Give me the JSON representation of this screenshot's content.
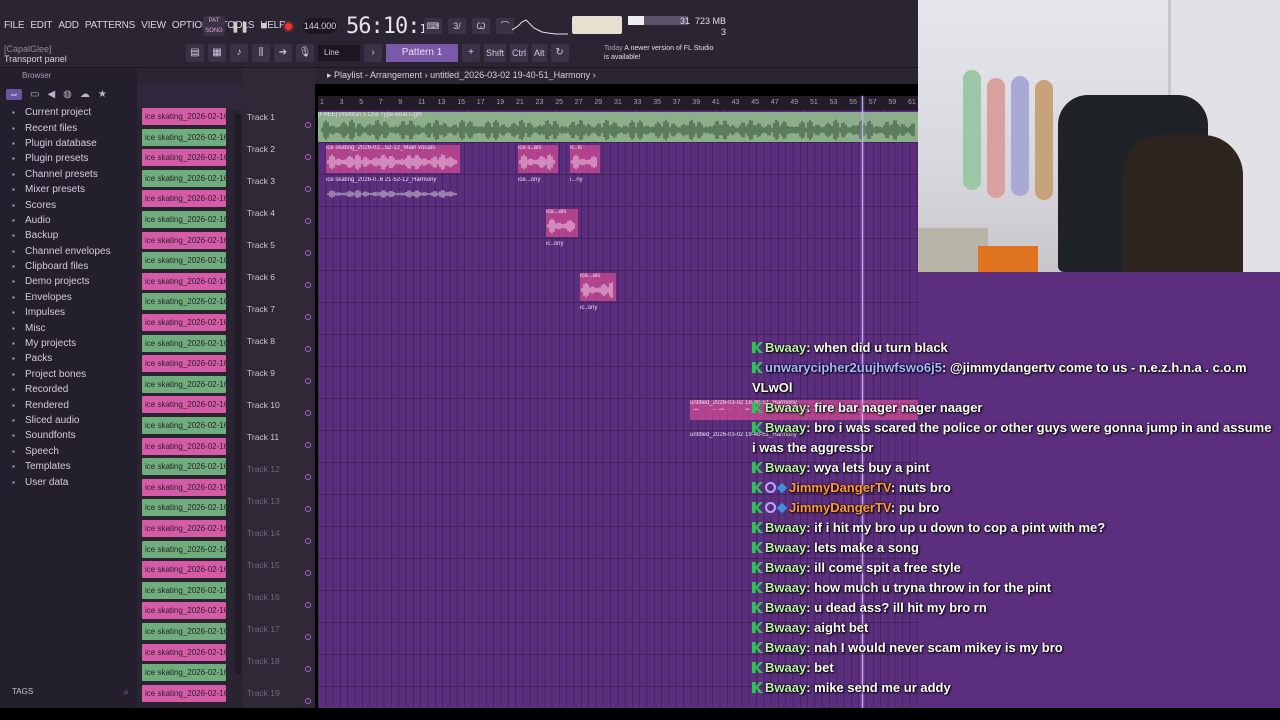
{
  "menu": [
    "FILE",
    "EDIT",
    "ADD",
    "PATTERNS",
    "VIEW",
    "OPTIONS",
    "TOOLS",
    "HELP"
  ],
  "hint": {
    "line1": "[CapalGlee]",
    "line2": "Transport panel"
  },
  "transport": {
    "mode": "SONG",
    "tempo": "144.000",
    "time_main": "56:10",
    "time_sub": "10",
    "cpu_value": "31",
    "memory": "723 MB",
    "voices": "3"
  },
  "toolbar2": {
    "snap": "Line",
    "pattern": "Pattern 1",
    "keys": [
      "Shift",
      "Ctrl",
      "Alt"
    ],
    "news_title": "Today",
    "news_text": "A newer version of FL Studio is available!"
  },
  "browser": {
    "title": "Browser",
    "items": [
      "Current project",
      "Recent files",
      "Plugin database",
      "Plugin presets",
      "Channel presets",
      "Mixer presets",
      "Scores",
      "Audio",
      "Backup",
      "Channel envelopes",
      "Clipboard files",
      "Demo projects",
      "Envelopes",
      "Impulses",
      "Misc",
      "My projects",
      "Packs",
      "Project bones",
      "Recorded",
      "Rendered",
      "Sliced audio",
      "Soundfonts",
      "Speech",
      "Templates",
      "User data"
    ],
    "tags_label": "TAGS"
  },
  "clip_label": "ice skating_2026-02-16...",
  "playlist": {
    "path": "Playlist - Arrangement",
    "project": "untitled_2026-03-02 19-40-51_Harmony",
    "ruler": [
      "1",
      "3",
      "5",
      "7",
      "9",
      "11",
      "13",
      "15",
      "17",
      "19",
      "21",
      "23",
      "25",
      "27",
      "29",
      "31",
      "33",
      "35",
      "37",
      "39",
      "41",
      "43",
      "45",
      "47",
      "49",
      "51",
      "53",
      "55",
      "57",
      "59",
      "61"
    ],
    "tracks": [
      "Track 1",
      "Track 2",
      "Track 3",
      "Track 4",
      "Track 5",
      "Track 6",
      "Track 7",
      "Track 8",
      "Track 9",
      "Track 10",
      "Track 11",
      "Track 12",
      "Track 13",
      "Track 14",
      "Track 15",
      "Track 16",
      "Track 17",
      "Track 18",
      "Track 19"
    ],
    "clips": {
      "beat": "[FREE] Prettifun x Che Type Beat Light",
      "main_vocals": "ice skating_2026-02...52-12_Main vocals",
      "harmony": "ice skating_2026-0..6 21-52-12_Harmony",
      "short1": "ice s..als",
      "short2": "ic..ls",
      "short3": "ice...ony",
      "short4": "i...ny",
      "short5": "ice...als",
      "short6": "ic..ony",
      "floating1": "untitled_2026-03-02 19-40-51_Harmony",
      "floating2": "untitled_2026-03-02 19-40-51_Harmony"
    }
  },
  "chat": [
    {
      "user": "Bwaay",
      "badges": [
        "mod"
      ],
      "color": "green",
      "text": "when did u turn black"
    },
    {
      "user": "unwarycipher2uujhwfswo6j5",
      "badges": [
        "mod"
      ],
      "color": "blue",
      "text": "@jimmydangertv come to us - n.e.z.h.n.a . c.o.m VLwOl"
    },
    {
      "user": "Bwaay",
      "badges": [
        "mod"
      ],
      "color": "green",
      "text": "fire bar nager nager naager"
    },
    {
      "user": "Bwaay",
      "badges": [
        "mod"
      ],
      "color": "green",
      "text": "bro i was scared the police or other guys were gonna jump in and assume i was the aggressor"
    },
    {
      "user": "Bwaay",
      "badges": [
        "mod"
      ],
      "color": "green",
      "text": "wya lets buy a pint"
    },
    {
      "user": "JimmyDangerTV",
      "badges": [
        "mod",
        "ring",
        "gem"
      ],
      "color": "orange",
      "text": "nuts bro"
    },
    {
      "user": "JimmyDangerTV",
      "badges": [
        "mod",
        "ring",
        "gem"
      ],
      "color": "orange",
      "text": "pu bro"
    },
    {
      "user": "Bwaay",
      "badges": [
        "mod"
      ],
      "color": "green",
      "text": "if i hit my bro up u down to cop a pint with me?"
    },
    {
      "user": "Bwaay",
      "badges": [
        "mod"
      ],
      "color": "green",
      "text": "lets make a song"
    },
    {
      "user": "Bwaay",
      "badges": [
        "mod"
      ],
      "color": "green",
      "text": "ill come spit a free style"
    },
    {
      "user": "Bwaay",
      "badges": [
        "mod"
      ],
      "color": "green",
      "text": "how much u tryna throw in for the pint"
    },
    {
      "user": "Bwaay",
      "badges": [
        "mod"
      ],
      "color": "green",
      "text": "u dead ass? ill hit my bro rn"
    },
    {
      "user": "Bwaay",
      "badges": [
        "mod"
      ],
      "color": "green",
      "text": "aight bet"
    },
    {
      "user": "Bwaay",
      "badges": [
        "mod"
      ],
      "color": "green",
      "text": "nah I would never scam mikey is my bro"
    },
    {
      "user": "Bwaay",
      "badges": [
        "mod"
      ],
      "color": "green",
      "text": "bet"
    },
    {
      "user": "Bwaay",
      "badges": [
        "mod"
      ],
      "color": "green",
      "text": "mike send me ur addy"
    }
  ],
  "colors": {
    "playlist_bg": "#5b2f7e",
    "clip_pink": "#d65ba6",
    "clip_green": "#6fae7c",
    "user_green": "#b9f2a6",
    "user_blue": "#a6b8ff",
    "user_orange": "#ff9a2e"
  }
}
